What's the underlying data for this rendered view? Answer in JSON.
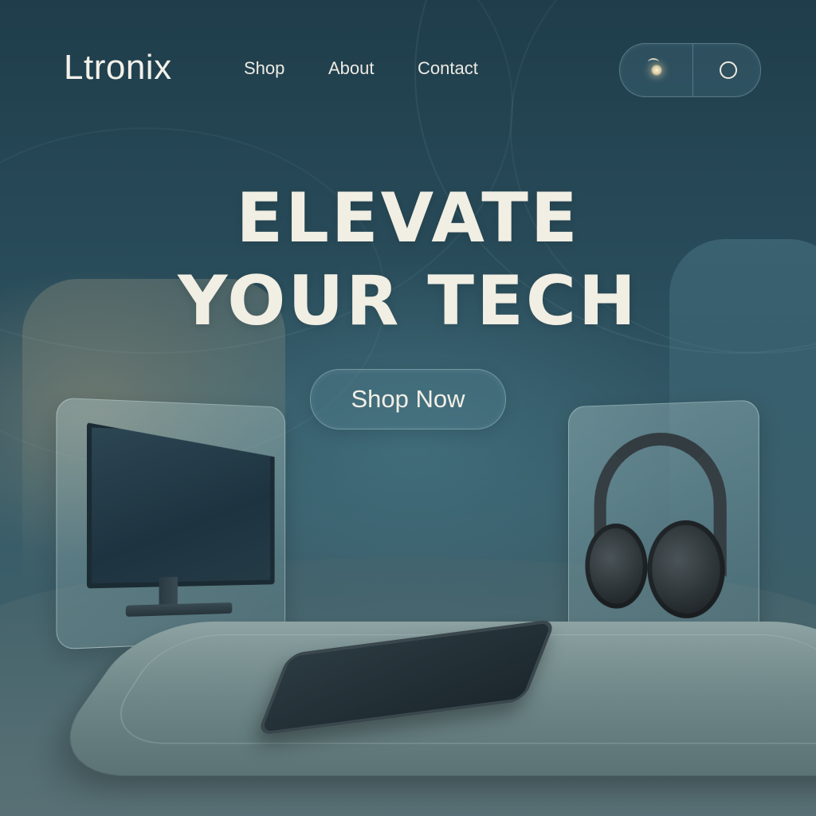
{
  "brand": {
    "name": "Ltronix"
  },
  "nav": {
    "links": [
      {
        "label": "Shop"
      },
      {
        "label": "About"
      },
      {
        "label": "Contact"
      }
    ]
  },
  "theme_toggle": {
    "left_icon": "moon-icon",
    "right_icon": "circle-icon"
  },
  "hero": {
    "line1": "ELEVATE",
    "line2": "YOUR TECH",
    "cta_label": "Shop Now"
  },
  "products": [
    {
      "icon": "monitor-icon"
    },
    {
      "icon": "headphones-icon"
    },
    {
      "icon": "smartphone-icon"
    }
  ],
  "colors": {
    "background": "#2a4d5b",
    "text": "#f1eee3",
    "glass": "#9fc0c4"
  }
}
